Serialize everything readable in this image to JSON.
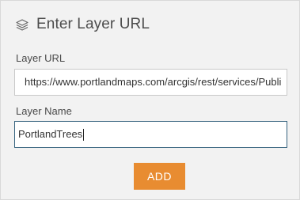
{
  "header": {
    "icon": "layers-icon",
    "title": "Enter Layer URL"
  },
  "form": {
    "url_label": "Layer URL",
    "url_value": "https://www.portlandmaps.com/arcgis/rest/services/Publi",
    "name_label": "Layer Name",
    "name_value": "PortlandTrees"
  },
  "actions": {
    "add_label": "ADD"
  },
  "colors": {
    "accent": "#e88c31",
    "focus_border": "#35627e",
    "panel_background": "#f2f2f2"
  }
}
